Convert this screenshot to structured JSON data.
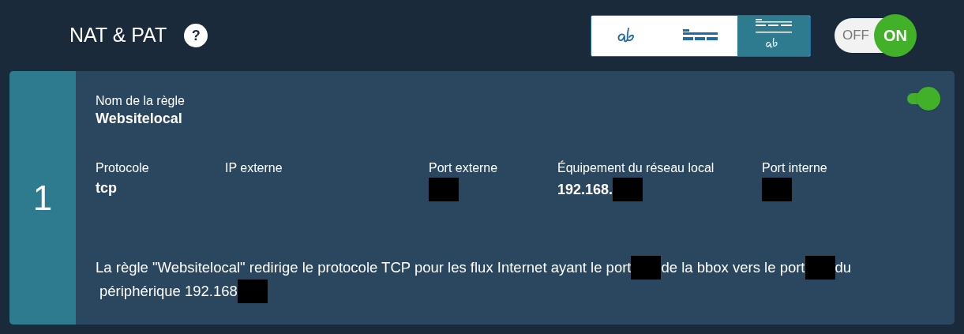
{
  "header": {
    "title": "NAT & PAT",
    "help": "?"
  },
  "view_modes": [
    {
      "kind": "script",
      "selected": false
    },
    {
      "kind": "lines",
      "selected": false
    },
    {
      "kind": "both",
      "selected": true
    }
  ],
  "master_switch": {
    "off_label": "OFF",
    "on_label": "ON",
    "on": true
  },
  "rule": {
    "number": "1",
    "enabled": true,
    "name_label": "Nom de la règle",
    "name": "Websitelocal",
    "fields": [
      {
        "label": "Protocole",
        "value": "tcp",
        "redacted": false
      },
      {
        "label": "IP externe",
        "redacted": false
      },
      {
        "label": "Port externe",
        "redacted": true
      },
      {
        "label": "Équipement du réseau local",
        "value": "192.168.",
        "redacted": true
      },
      {
        "label": "Port interne",
        "redacted": true
      }
    ],
    "description": [
      {
        "kind": "text",
        "text": "La règle \"Websitelocal\" redirige le protocole TCP pour les flux Internet ayant le port"
      },
      {
        "kind": "redacted"
      },
      {
        "kind": "text",
        "text": "de la bbox vers le port"
      },
      {
        "kind": "redacted"
      },
      {
        "kind": "text",
        "text": "du"
      },
      {
        "kind": "text",
        "text": "périphérique 192.168"
      },
      {
        "kind": "redacted"
      }
    ]
  }
}
